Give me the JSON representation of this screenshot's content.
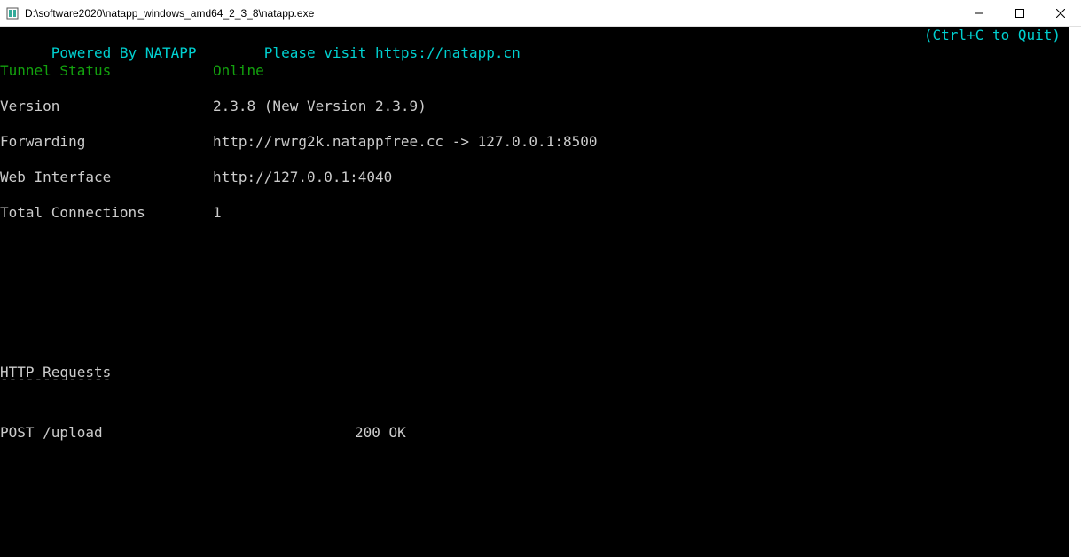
{
  "titlebar": {
    "title": "D:\\software2020\\natapp_windows_amd64_2_3_8\\natapp.exe"
  },
  "terminal": {
    "header": {
      "powered": "Powered By NATAPP",
      "visit": "Please visit https://natapp.cn",
      "quitHint": "(Ctrl+C to Quit)"
    },
    "rows": {
      "tunnelStatusLabel": "Tunnel Status",
      "tunnelStatusValue": "Online",
      "versionLabel": "Version",
      "versionValue": "2.3.8 (New Version 2.3.9)",
      "forwardingLabel": "Forwarding",
      "forwardingValue": "http://rwrg2k.natappfree.cc -> 127.0.0.1:8500",
      "webInterfaceLabel": "Web Interface",
      "webInterfaceValue": "http://127.0.0.1:4040",
      "totalConnectionsLabel": "Total Connections",
      "totalConnectionsValue": "1"
    },
    "httpSection": {
      "title": "HTTP Requests",
      "underline": "-------------",
      "request": "POST /upload",
      "status": "200 OK"
    }
  }
}
